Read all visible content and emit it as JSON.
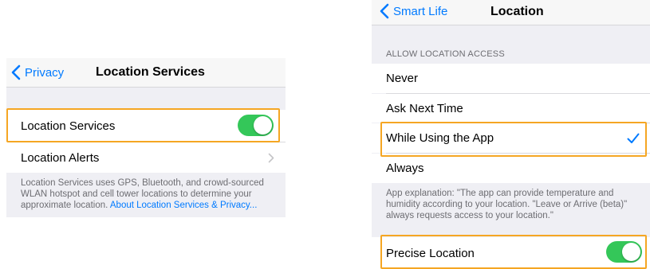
{
  "left_screen": {
    "back_label": "Privacy",
    "title": "Location Services",
    "location_services_label": "Location Services",
    "location_services_enabled": true,
    "location_alerts_label": "Location Alerts",
    "footer_text": "Location Services uses GPS, Bluetooth, and crowd-sourced WLAN hotspot and cell tower locations to determine your approximate location.",
    "footer_link": "About Location Services & Privacy..."
  },
  "right_screen": {
    "back_label": "Smart Life",
    "title": "Location",
    "section_header": "ALLOW LOCATION ACCESS",
    "options": [
      "Never",
      "Ask Next Time",
      "While Using the App",
      "Always"
    ],
    "selected_option": "While Using the App",
    "explanation": "App explanation: \"The app can provide temperature and humidity according to your location. \"Leave or Arrive (beta)\" always requests access to your location.\"",
    "precise_location_label": "Precise Location",
    "precise_location_enabled": true
  },
  "colors": {
    "accent": "#007aff",
    "toggle_on": "#34c759",
    "highlight": "#f5a623",
    "grouped_background": "#efeff4"
  }
}
